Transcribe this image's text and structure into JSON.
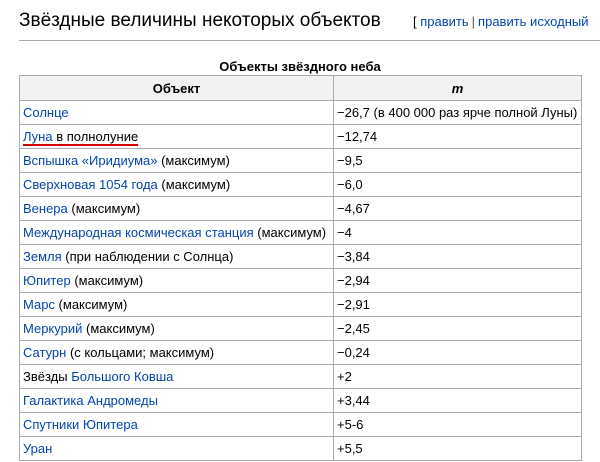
{
  "heading": {
    "title": "Звёздные величины некоторых объектов",
    "bracket_open": "[",
    "edit_link": "править",
    "separator": "|",
    "edit_source_link": "править исходный"
  },
  "table": {
    "caption": "Объекты звёздного неба",
    "headers": [
      "Объект",
      "m"
    ],
    "rows": [
      {
        "link": "Солнце",
        "rest": "",
        "m": "−26,7 (в 400 000 раз ярче полной Луны)"
      },
      {
        "link": "Луна",
        "rest": "в полнолуние",
        "m": "−12,74"
      },
      {
        "link": "Вспышка «Иридиума»",
        "rest": " (максимум)",
        "m": "−9,5"
      },
      {
        "link": "Сверхновая 1054 года",
        "rest": " (максимум)",
        "m": "−6,0"
      },
      {
        "link": "Венера",
        "rest": " (максимум)",
        "m": "−4,67"
      },
      {
        "link": "Международная космическая станция",
        "rest": " (максимум)",
        "m": "−4"
      },
      {
        "link": "Земля",
        "rest": " (при наблюдении с Солнца)",
        "m": "−3,84"
      },
      {
        "link": "Юпитер",
        "rest": " (максимум)",
        "m": "−2,94"
      },
      {
        "link": "Марс",
        "rest": " (максимум)",
        "m": "−2,91"
      },
      {
        "link": "Меркурий",
        "rest": " (максимум)",
        "m": "−2,45"
      },
      {
        "link": "Сатурн",
        "rest": " (с кольцами; максимум)",
        "m": "−0,24"
      },
      {
        "prefix": "Звёзды ",
        "link": "Большого Ковша",
        "m": "+2"
      },
      {
        "link": "Галактика Андромеды",
        "rest": "",
        "m": "+3,44"
      },
      {
        "link": "Спутники Юпитера",
        "rest": "",
        "m": "+5-6"
      },
      {
        "link": "Уран",
        "rest": "",
        "m": "+5,5"
      }
    ]
  },
  "colors": {
    "link": "#0645ad",
    "border": "#aaaaaa",
    "header_bg": "#f2f2f2",
    "annotation": "#d00000"
  }
}
